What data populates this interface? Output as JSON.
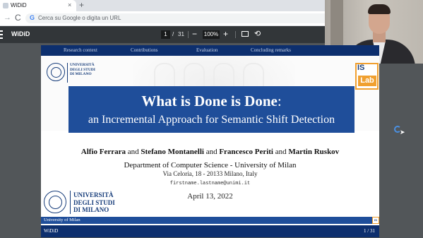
{
  "browser": {
    "tab_title": "WiDiD",
    "tab_close": "×",
    "new_tab": "+",
    "back": "→",
    "reload": "C",
    "omnibox_icon": "G",
    "omnibox_placeholder": "Cerca su Google o digita un URL"
  },
  "pdf_toolbar": {
    "doc_title": "WiDiD",
    "current_page": "1",
    "page_separator": "/",
    "total_pages": "31",
    "zoom": "100%",
    "zoom_minus": "−",
    "zoom_plus": "+"
  },
  "slide": {
    "nav": [
      "Research context",
      "Contributions",
      "Evaluation",
      "Concluding remarks"
    ],
    "university_small": [
      "UNIVERSITÀ",
      "DEGLI STUDI",
      "DI MILANO"
    ],
    "islab_top": "IS",
    "islab_bottom": "Lab",
    "title_main": "What is Done is Done",
    "title_colon": ":",
    "title_sub": "an Incremental Approach for Semantic Shift Detection",
    "authors": [
      "Alfio Ferrara",
      "Stefano Montanelli",
      "Francesco Periti",
      "Martin Ruskov"
    ],
    "author_connector": "and",
    "department": "Department of Computer Science - University of Milan",
    "address": "Via Celoria, 18 - 20133 Milano, Italy",
    "email": "firstname.lastname@unimi.it",
    "date": "April 13, 2022",
    "university_big": [
      "UNIVERSITÀ",
      "DEGLI STUDI",
      "DI MILANO"
    ],
    "strip_text": "University of Milan",
    "footer_left": "WiDiD",
    "footer_right": "1 / 31"
  },
  "colors": {
    "accent_blue": "#1f4e9a",
    "nav_blue": "#0d2f6e",
    "islab_orange": "#f0a030",
    "toolbar_dark": "#323639"
  }
}
